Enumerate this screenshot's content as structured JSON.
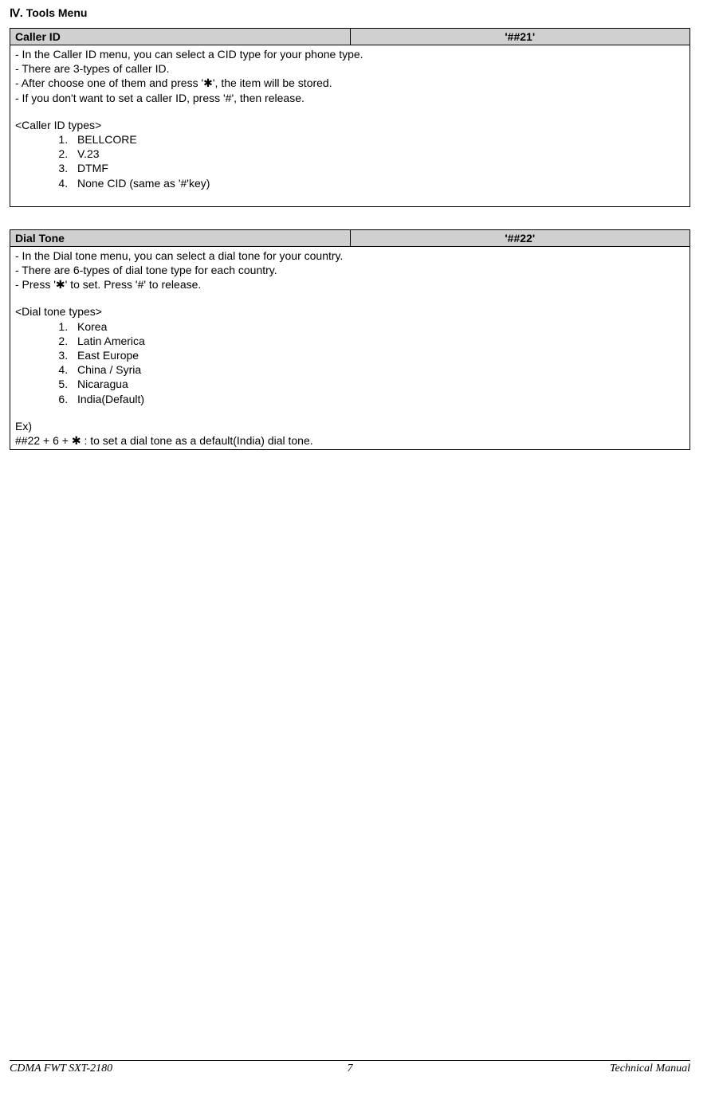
{
  "section_title": "Ⅳ. Tools Menu",
  "table1": {
    "header_left": "Caller ID",
    "header_right": "'##21'",
    "line1": "- In the Caller ID menu, you can select a CID type for your phone type.",
    "line2": "- There are 3-types of caller ID.",
    "line3": "- After choose one of them and press '✱', the item will be stored.",
    "line4": "- If you don't want to set a caller ID, press '#', then release.",
    "list_title": "<Caller ID types>",
    "items": {
      "i1": "BELLCORE",
      "i2": "V.23",
      "i3": "DTMF",
      "i4": "None CID (same as '#'key)"
    }
  },
  "table2": {
    "header_left": "Dial Tone",
    "header_right": "'##22'",
    "line1": "- In the Dial tone menu, you can select a dial tone for your country.",
    "line2": "- There are 6-types of dial tone type for each country.",
    "line3": "- Press '✱' to set. Press '#' to release.",
    "list_title": "<Dial tone types>",
    "items": {
      "i1": "Korea",
      "i2": "Latin America",
      "i3": "East Europe",
      "i4": "China / Syria",
      "i5": "Nicaragua",
      "i6": "India(Default)"
    },
    "ex_label": "Ex)",
    "ex_text": "##22 + 6 + ✱ : to set a dial tone as a default(India) dial tone."
  },
  "footer": {
    "left": "CDMA FWT SXT-2180",
    "center": "7",
    "right": "Technical Manual"
  }
}
